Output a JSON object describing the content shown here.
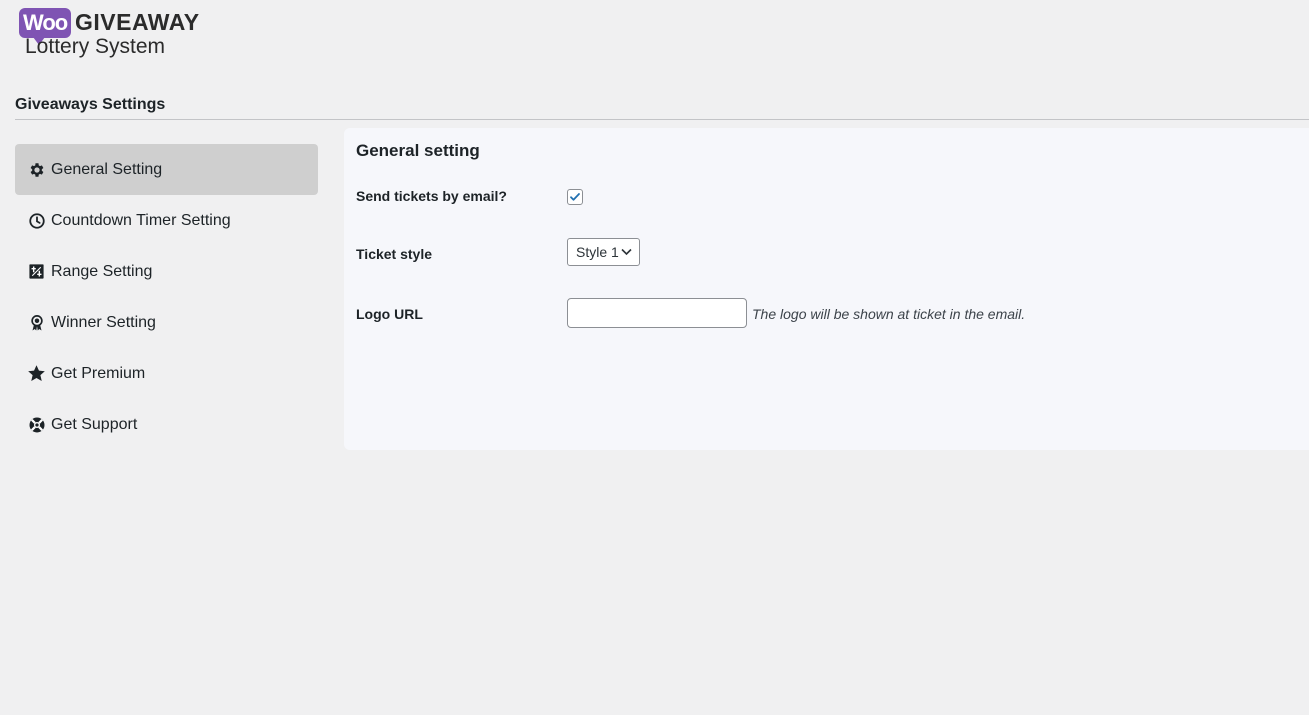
{
  "brand": {
    "woo": "Woo",
    "title": "GIVEAWAY",
    "subtitle": "Lottery System"
  },
  "page": {
    "title": "Giveaways Settings"
  },
  "sidebar": {
    "items": [
      {
        "label": "General Setting",
        "icon": "gear-icon",
        "active": true
      },
      {
        "label": "Countdown Timer Setting",
        "icon": "clock-icon",
        "active": false
      },
      {
        "label": "Range Setting",
        "icon": "range-icon",
        "active": false
      },
      {
        "label": "Winner Setting",
        "icon": "award-icon",
        "active": false
      },
      {
        "label": "Get Premium",
        "icon": "star-icon",
        "active": false
      },
      {
        "label": "Get Support",
        "icon": "lifebuoy-icon",
        "active": false
      }
    ]
  },
  "panel": {
    "title": "General setting",
    "fields": {
      "send_tickets": {
        "label": "Send tickets by email?",
        "checked": true
      },
      "ticket_style": {
        "label": "Ticket style",
        "value": "Style 1"
      },
      "logo_url": {
        "label": "Logo URL",
        "value": "",
        "description": "The logo will be shown at ticket in the email."
      }
    }
  },
  "colors": {
    "background": "#f0f0f1",
    "panel": "#f6f7fb",
    "active_item": "#cfcfcf",
    "brand_purple": "#7f54b3",
    "checkbox_check": "#2271b1"
  }
}
